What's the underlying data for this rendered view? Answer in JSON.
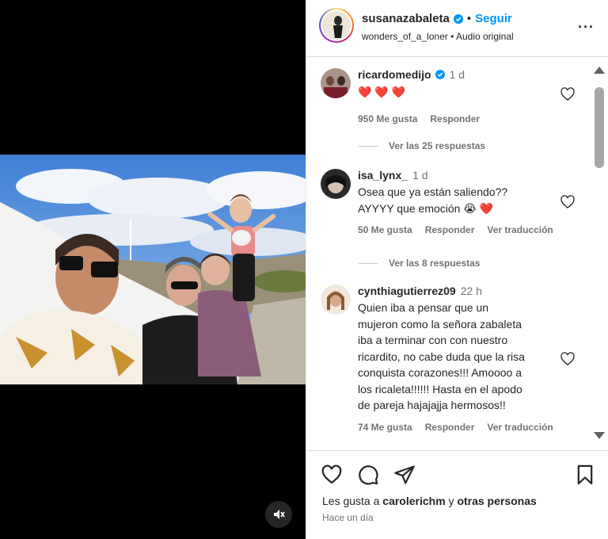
{
  "post": {
    "username": "susanazabaleta",
    "follow_label": "Seguir",
    "audio_user": "wonders_of_a_loner",
    "audio_label": "Audio original",
    "dot": "•"
  },
  "comments": [
    {
      "username": "ricardomedijo",
      "verified": true,
      "time": "1 d",
      "text": "❤️ ❤️ ❤️",
      "likes": "950 Me gusta",
      "reply_label": "Responder",
      "view_replies": "Ver las 25 respuestas"
    },
    {
      "username": "isa_lynx_",
      "time": "1 d",
      "text_line1": "Osea que ya están saliendo??",
      "text_line2": "AYYYY que emoción 😭 ❤️",
      "likes": "50 Me gusta",
      "reply_label": "Responder",
      "translate_label": "Ver traducción",
      "view_replies": "Ver las 8 respuestas"
    },
    {
      "username": "cynthiagutierrez09",
      "time": "22 h",
      "text_lines": [
        "Quien iba a pensar que un",
        "mujeron como la señora zabaleta",
        "iba a terminar con con nuestro",
        "ricardito, no cabe duda que la risa",
        "conquista corazones!!! Amoooo a",
        "los ricaleta!!!!!! Hasta en el apodo",
        "de pareja hajajajja hermosos!!"
      ],
      "likes": "74 Me gusta",
      "reply_label": "Responder",
      "translate_label": "Ver traducción"
    }
  ],
  "footer": {
    "likes_prefix": "Les gusta a ",
    "likes_user": "carolerichm",
    "likes_connector": " y ",
    "likes_others": "otras personas",
    "date": "Hace un día"
  },
  "icons": {
    "like": "heart-icon",
    "comment": "comment-icon",
    "share": "share-icon",
    "save": "bookmark-icon",
    "mute": "speaker-muted-icon",
    "more": "more-options-icon"
  },
  "colors": {
    "link_blue": "#0095f6",
    "text": "#262626",
    "muted": "#737373",
    "verified": "#0095f6"
  }
}
